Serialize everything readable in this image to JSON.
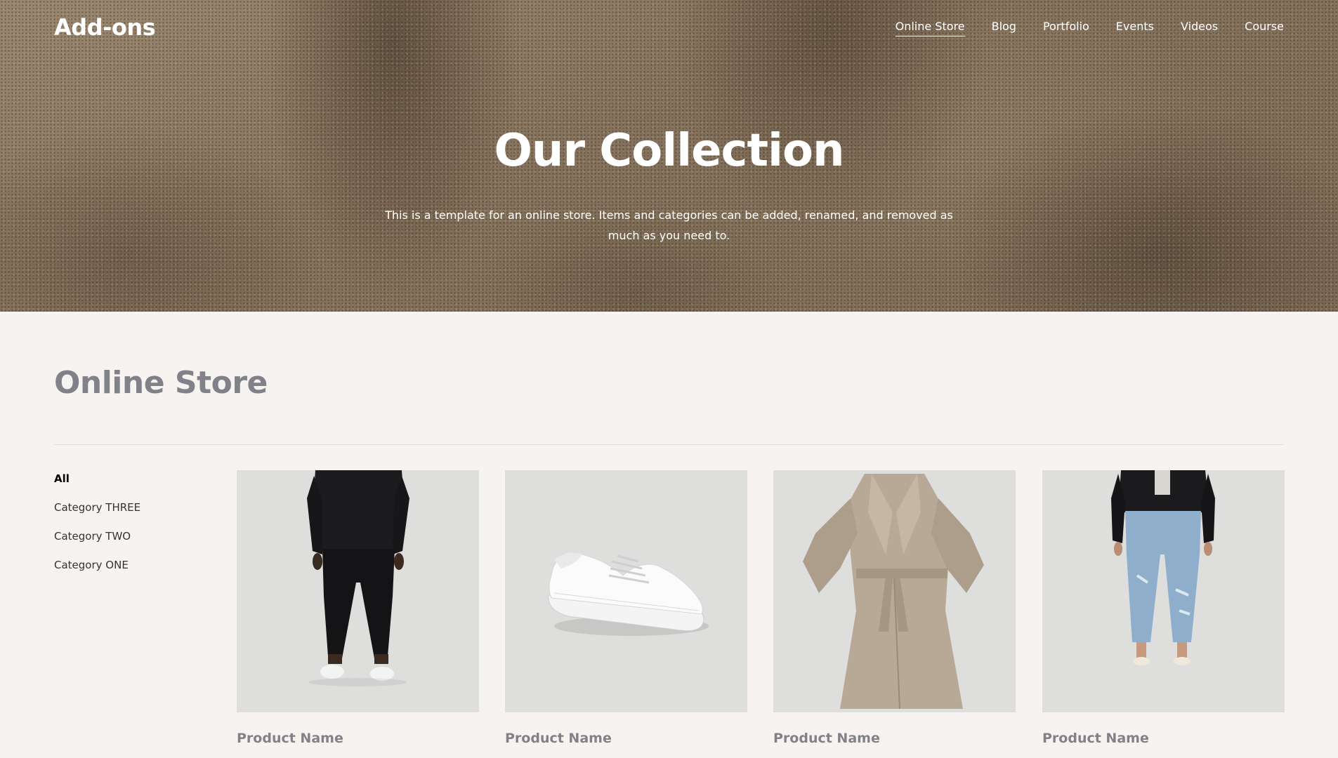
{
  "header": {
    "brand": "Add-ons",
    "nav": [
      {
        "label": "Online Store",
        "active": true
      },
      {
        "label": "Blog",
        "active": false
      },
      {
        "label": "Portfolio",
        "active": false
      },
      {
        "label": "Events",
        "active": false
      },
      {
        "label": "Videos",
        "active": false
      },
      {
        "label": "Course",
        "active": false
      }
    ]
  },
  "hero": {
    "title": "Our Collection",
    "description": "This is a template for an online store. Items and categories can be added, renamed, and removed as much as you need to."
  },
  "store": {
    "title": "Online Store",
    "categories": [
      {
        "label": "All",
        "active": true
      },
      {
        "label": "Category THREE",
        "active": false
      },
      {
        "label": "Category TWO",
        "active": false
      },
      {
        "label": "Category ONE",
        "active": false
      }
    ],
    "products": [
      {
        "name": "Product Name",
        "image": "black-outfit-image"
      },
      {
        "name": "Product Name",
        "image": "white-sneaker-image"
      },
      {
        "name": "Product Name",
        "image": "trench-coat-image"
      },
      {
        "name": "Product Name",
        "image": "jeans-leather-jacket-image"
      }
    ]
  },
  "colors": {
    "page_background": "#f7f3f0",
    "hero_tone": "#8a7862",
    "muted_heading": "#818189",
    "product_tile": "#dededd"
  }
}
